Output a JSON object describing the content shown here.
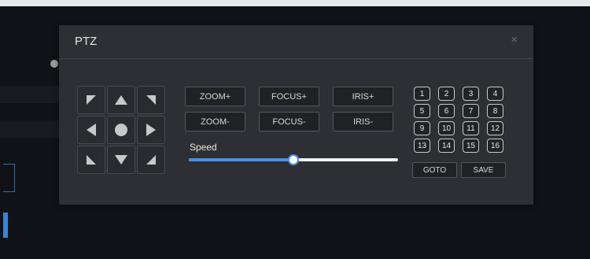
{
  "dialog": {
    "title": "PTZ",
    "close_glyph": "×"
  },
  "dpad": {
    "buttons": [
      {
        "name": "pan-up-left",
        "icon": "arrow-up-left-icon"
      },
      {
        "name": "tilt-up",
        "icon": "arrow-up-icon"
      },
      {
        "name": "pan-up-right",
        "icon": "arrow-up-right-icon"
      },
      {
        "name": "pan-left",
        "icon": "arrow-left-icon"
      },
      {
        "name": "center",
        "icon": "circle-icon"
      },
      {
        "name": "pan-right",
        "icon": "arrow-right-icon"
      },
      {
        "name": "pan-down-left",
        "icon": "arrow-down-left-icon"
      },
      {
        "name": "tilt-down",
        "icon": "arrow-down-icon"
      },
      {
        "name": "pan-down-right",
        "icon": "arrow-down-right-icon"
      }
    ]
  },
  "controls": {
    "zoom_in": "ZOOM+",
    "focus_in": "FOCUS+",
    "iris_in": "IRIS+",
    "zoom_out": "ZOOM-",
    "focus_out": "FOCUS-",
    "iris_out": "IRIS-"
  },
  "speed": {
    "label": "Speed",
    "value_fraction": 0.5
  },
  "presets": {
    "numbers": [
      "1",
      "2",
      "3",
      "4",
      "5",
      "6",
      "7",
      "8",
      "9",
      "10",
      "11",
      "12",
      "13",
      "14",
      "15",
      "16"
    ],
    "goto_label": "GOTO",
    "save_label": "SAVE"
  },
  "colors": {
    "dialog_bg": "#2e2f34",
    "accent": "#4a90e8",
    "icon": "#c8c8c8"
  }
}
